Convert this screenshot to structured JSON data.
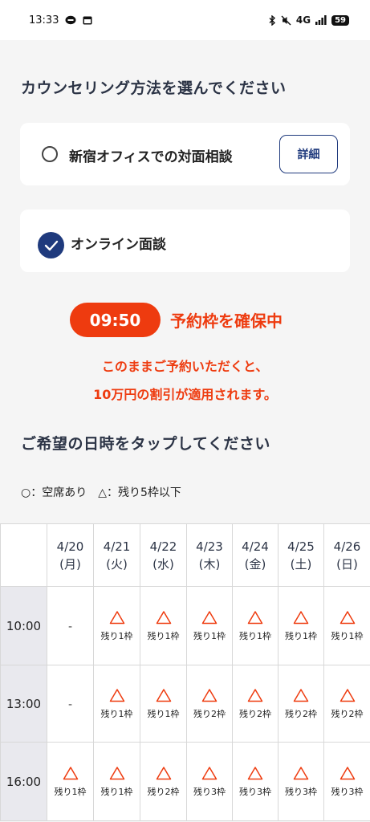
{
  "status_bar": {
    "time": "13:33",
    "network": "4G",
    "battery": "59"
  },
  "method_section": {
    "title": "カウンセリング方法を選んでください"
  },
  "options": [
    {
      "label": "新宿オフィスでの対面相談",
      "selected": false,
      "detail_label": "詳細"
    },
    {
      "label": "オンライン面談",
      "selected": true
    }
  ],
  "reservation": {
    "timer": "09:50",
    "status": "予約枠を確保中",
    "promo_line1": "このままご予約いただくと、",
    "promo_line2": "10万円の割引が適用されます。"
  },
  "datetime_section": {
    "title": "ご希望の日時をタップしてください"
  },
  "legend": {
    "text": "○：空席あり　△：残り5枠以下"
  },
  "schedule": {
    "days": [
      {
        "date": "4/20",
        "weekday": "(月)"
      },
      {
        "date": "4/21",
        "weekday": "(火)"
      },
      {
        "date": "4/22",
        "weekday": "(水)"
      },
      {
        "date": "4/23",
        "weekday": "(木)"
      },
      {
        "date": "4/24",
        "weekday": "(金)"
      },
      {
        "date": "4/25",
        "weekday": "(土)"
      },
      {
        "date": "4/26",
        "weekday": "(日)"
      }
    ],
    "rows": [
      {
        "time": "10:00",
        "slots": [
          {
            "mark": "-"
          },
          {
            "mark": "△",
            "remain": "残り1枠"
          },
          {
            "mark": "△",
            "remain": "残り1枠"
          },
          {
            "mark": "△",
            "remain": "残り1枠"
          },
          {
            "mark": "△",
            "remain": "残り1枠"
          },
          {
            "mark": "△",
            "remain": "残り1枠"
          },
          {
            "mark": "△",
            "remain": "残り1枠"
          }
        ]
      },
      {
        "time": "13:00",
        "slots": [
          {
            "mark": "-"
          },
          {
            "mark": "△",
            "remain": "残り1枠"
          },
          {
            "mark": "△",
            "remain": "残り1枠"
          },
          {
            "mark": "△",
            "remain": "残り2枠"
          },
          {
            "mark": "△",
            "remain": "残り2枠"
          },
          {
            "mark": "△",
            "remain": "残り2枠"
          },
          {
            "mark": "△",
            "remain": "残り2枠"
          }
        ]
      },
      {
        "time": "16:00",
        "slots": [
          {
            "mark": "△",
            "remain": "残り1枠"
          },
          {
            "mark": "△",
            "remain": "残り1枠"
          },
          {
            "mark": "△",
            "remain": "残り2枠"
          },
          {
            "mark": "△",
            "remain": "残り3枠"
          },
          {
            "mark": "△",
            "remain": "残り3枠"
          },
          {
            "mark": "△",
            "remain": "残り3枠"
          },
          {
            "mark": "△",
            "remain": "残り3枠"
          }
        ]
      }
    ]
  },
  "colors": {
    "accent": "#ee3b0f",
    "navy": "#1f3a7d",
    "text": "#2c3446"
  }
}
